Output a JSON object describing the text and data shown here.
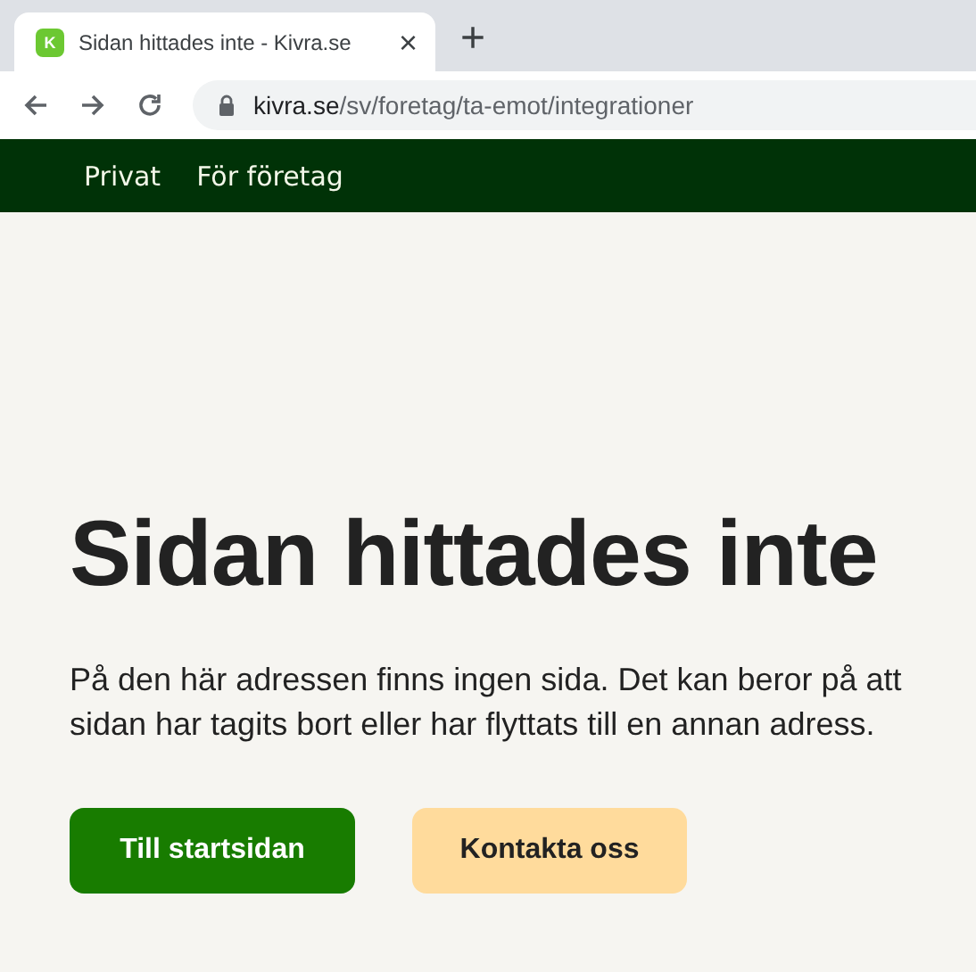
{
  "browser": {
    "tab": {
      "favicon": "K",
      "title": "Sidan hittades inte - Kivra.se",
      "close": "×"
    },
    "new_tab": "+",
    "address": {
      "domain": "kivra.se",
      "path": "/sv/foretag/ta-emot/integrationer"
    }
  },
  "nav": [
    {
      "label": "Privat"
    },
    {
      "label": "För företag"
    }
  ],
  "heading": "Sidan hittades inte",
  "message": "På den här adressen finns ingen sida. Det kan beror på att sidan har tagits bort eller har flyttats till en annan adress.",
  "buttons": [
    {
      "label": "Till startsidan",
      "kind": "primary"
    },
    {
      "label": "Kontakta oss",
      "kind": "secondary"
    }
  ]
}
